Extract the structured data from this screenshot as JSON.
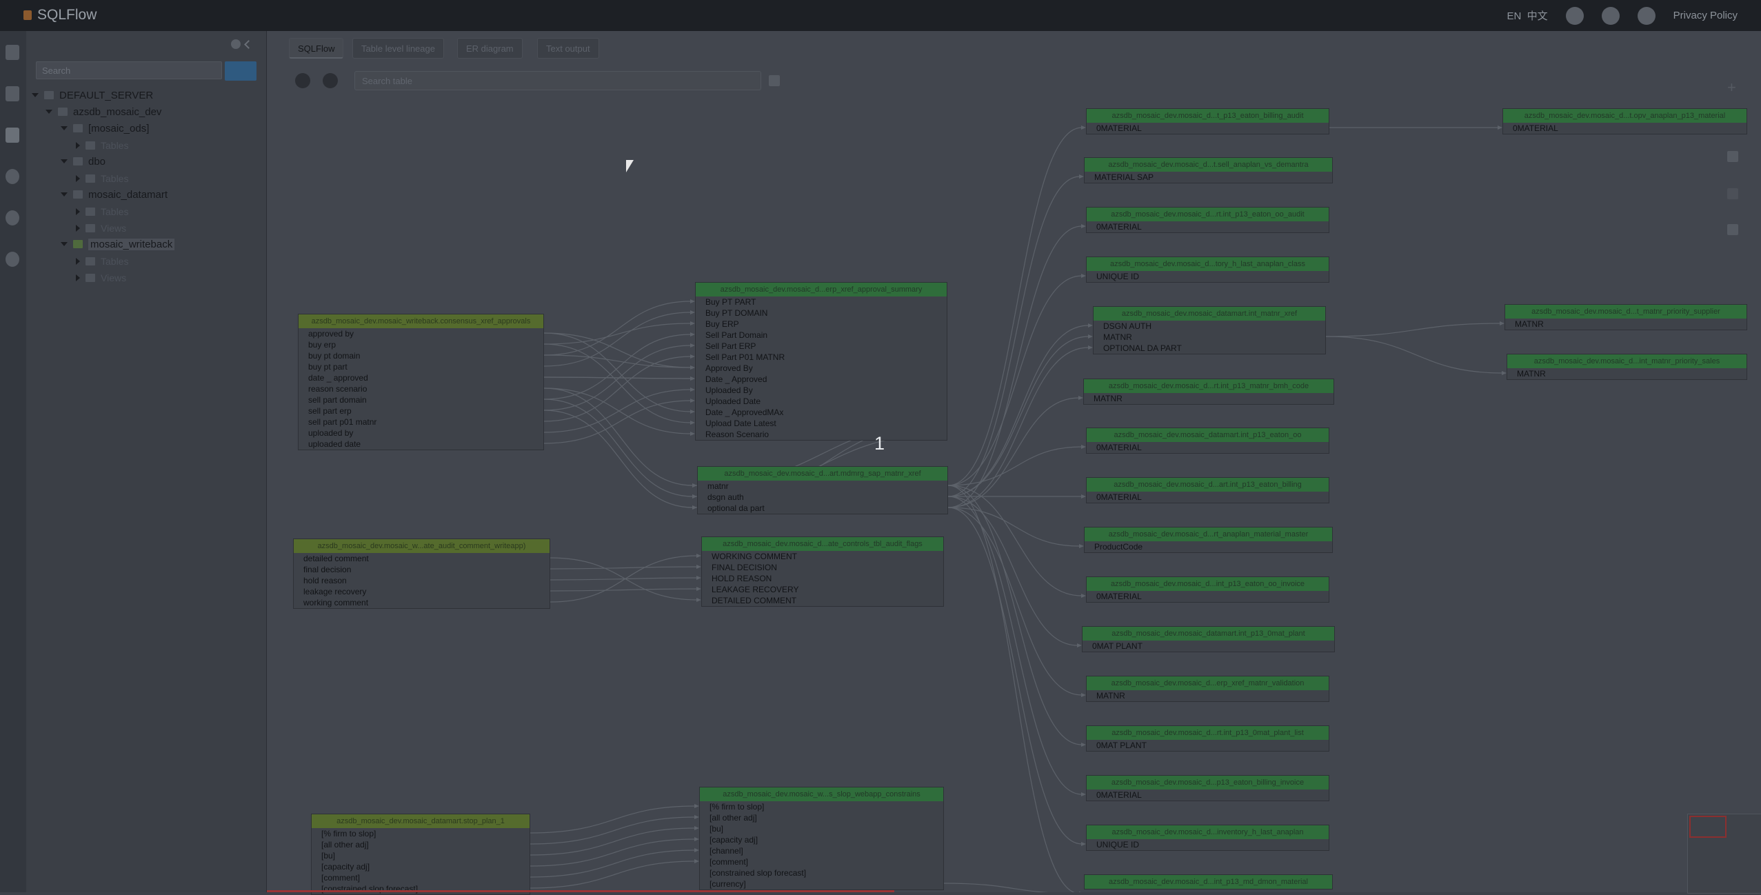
{
  "app": {
    "title": "SQLFlow"
  },
  "header": {
    "lang_en": "EN",
    "lang_zh": "中文",
    "privacy": "Privacy Policy"
  },
  "tree": {
    "search_placeholder": "Search",
    "server": "DEFAULT_SERVER",
    "database": "azsdb_mosaic_dev",
    "schemas": [
      {
        "name": "[mosaic_ods]",
        "children": [
          "Tables"
        ]
      },
      {
        "name": "dbo",
        "children": [
          "Tables"
        ]
      },
      {
        "name": "mosaic_datamart",
        "children": [
          "Tables",
          "Views"
        ]
      },
      {
        "name": "mosaic_writeback",
        "children": [
          "Tables",
          "Views"
        ]
      }
    ]
  },
  "tabs": [
    "SQLFlow",
    "Table level lineage",
    "ER diagram",
    "Text output"
  ],
  "main": {
    "sql_search_placeholder": "Search table",
    "page_number": "1"
  },
  "diagram": {
    "tables": [
      {
        "id": "s1",
        "kind": "src",
        "title": "azsdb_mosaic_dev.mosaic_writeback.consensus_xref_approvals",
        "cols": [
          "approved by",
          "buy erp",
          "buy pt domain",
          "buy pt part",
          "date _ approved",
          "reason scenario",
          "sell part domain",
          "sell part erp",
          "sell part p01 matnr",
          "uploaded by",
          "uploaded date"
        ]
      },
      {
        "id": "s2",
        "kind": "src",
        "title": "azsdb_mosaic_dev.mosaic_w...ate_audit_comment_writeapp)",
        "cols": [
          "detailed comment",
          "final decision",
          "hold reason",
          "leakage recovery",
          "working comment"
        ]
      },
      {
        "id": "s3",
        "kind": "src",
        "title": "azsdb_mosaic_dev.mosaic_datamart.stop_plan_1",
        "cols": [
          "[% firm to slop]",
          "[all other adj]",
          "[bu]",
          "[capacity adj]",
          "[comment]",
          "[constrained slop forecast]"
        ]
      },
      {
        "id": "m1",
        "kind": "tgt",
        "title": "azsdb_mosaic_dev.mosaic_d...erp_xref_approval_summary",
        "cols": [
          "Buy PT PART",
          "Buy PT DOMAIN",
          "Buy ERP",
          "Sell Part Domain",
          "Sell Part ERP",
          "Sell Part P01 MATNR",
          "Approved By",
          "Date _ Approved",
          "Uploaded By",
          "Uploaded Date",
          "Date _ ApprovedMAx",
          "Upload Date Latest",
          "Reason Scenario"
        ]
      },
      {
        "id": "m2",
        "kind": "tgt",
        "title": "azsdb_mosaic_dev.mosaic_d...art.mdmrg_sap_matnr_xref",
        "cols": [
          "matnr",
          "dsgn auth",
          "optional da part"
        ]
      },
      {
        "id": "m3",
        "kind": "tgt",
        "title": "azsdb_mosaic_dev.mosaic_d...ate_controls_tbl_audit_flags",
        "cols": [
          "WORKING COMMENT",
          "FINAL DECISION",
          "HOLD REASON",
          "LEAKAGE RECOVERY",
          "DETAILED COMMENT"
        ]
      },
      {
        "id": "m4",
        "kind": "tgt",
        "title": "azsdb_mosaic_dev.mosaic_w...s_slop_webapp_constrains",
        "cols": [
          "[% firm to slop]",
          "[all other adj]",
          "[bu]",
          "[capacity adj]",
          "[channel]",
          "[comment]",
          "[constrained slop forecast]",
          "[currency]"
        ]
      },
      {
        "id": "r1",
        "kind": "tgt",
        "title": "azsdb_mosaic_dev.mosaic_d...t_p13_eaton_billing_audit",
        "cols": [
          "0MATERIAL"
        ]
      },
      {
        "id": "r2",
        "kind": "tgt",
        "title": "azsdb_mosaic_dev.mosaic_d...t.sell_anaplan_vs_demantra",
        "cols": [
          "MATERIAL SAP"
        ]
      },
      {
        "id": "r3",
        "kind": "tgt",
        "title": "azsdb_mosaic_dev.mosaic_d...rt.int_p13_eaton_oo_audit",
        "cols": [
          "0MATERIAL"
        ]
      },
      {
        "id": "r4",
        "kind": "tgt",
        "title": "azsdb_mosaic_dev.mosaic_d...tory_h_last_anaplan_class",
        "cols": [
          "UNIQUE ID"
        ]
      },
      {
        "id": "r5",
        "kind": "tgt",
        "title": "azsdb_mosaic_dev.mosaic_datamart.int_matnr_xref",
        "cols": [
          "DSGN AUTH",
          "MATNR",
          "OPTIONAL DA PART"
        ]
      },
      {
        "id": "r6",
        "kind": "tgt",
        "title": "azsdb_mosaic_dev.mosaic_d...rt.int_p13_matnr_bmh_code",
        "cols": [
          "MATNR"
        ]
      },
      {
        "id": "r7",
        "kind": "tgt",
        "title": "azsdb_mosaic_dev.mosaic_datamart.int_p13_eaton_oo",
        "cols": [
          "0MATERIAL"
        ]
      },
      {
        "id": "r8",
        "kind": "tgt",
        "title": "azsdb_mosaic_dev.mosaic_d...art.int_p13_eaton_billing",
        "cols": [
          "0MATERIAL"
        ]
      },
      {
        "id": "r9",
        "kind": "tgt",
        "title": "azsdb_mosaic_dev.mosaic_d...rt_anaplan_material_master",
        "cols": [
          "ProductCode"
        ]
      },
      {
        "id": "r10",
        "kind": "tgt",
        "title": "azsdb_mosaic_dev.mosaic_d...int_p13_eaton_oo_invoice",
        "cols": [
          "0MATERIAL"
        ]
      },
      {
        "id": "r11",
        "kind": "tgt",
        "title": "azsdb_mosaic_dev.mosaic_datamart.int_p13_0mat_plant",
        "cols": [
          "0MAT PLANT"
        ]
      },
      {
        "id": "r12",
        "kind": "tgt",
        "title": "azsdb_mosaic_dev.mosaic_d...erp_xref_matnr_validation",
        "cols": [
          "MATNR"
        ]
      },
      {
        "id": "r13",
        "kind": "tgt",
        "title": "azsdb_mosaic_dev.mosaic_d...rt.int_p13_0mat_plant_list",
        "cols": [
          "0MAT PLANT"
        ]
      },
      {
        "id": "r14",
        "kind": "tgt",
        "title": "azsdb_mosaic_dev.mosaic_d...p13_eaton_billing_invoice",
        "cols": [
          "0MATERIAL"
        ]
      },
      {
        "id": "r15",
        "kind": "tgt",
        "title": "azsdb_mosaic_dev.mosaic_d...inventory_h_last_anaplan",
        "cols": [
          "UNIQUE ID"
        ]
      },
      {
        "id": "r16",
        "kind": "tgt",
        "title": "azsdb_mosaic_dev.mosaic_d...int_p13_md_dmon_material",
        "cols": []
      },
      {
        "id": "f1",
        "kind": "tgt",
        "title": "azsdb_mosaic_dev.mosaic_d...t.opv_anaplan_p13_material",
        "cols": [
          "0MATERIAL"
        ]
      },
      {
        "id": "f2",
        "kind": "tgt",
        "title": "azsdb_mosaic_dev.mosaic_d...t_matnr_priority_supplier",
        "cols": [
          "MATNR"
        ]
      },
      {
        "id": "f3",
        "kind": "tgt",
        "title": "azsdb_mosaic_dev.mosaic_d...int_matnr_priority_sales",
        "cols": [
          "MATNR"
        ]
      }
    ]
  }
}
